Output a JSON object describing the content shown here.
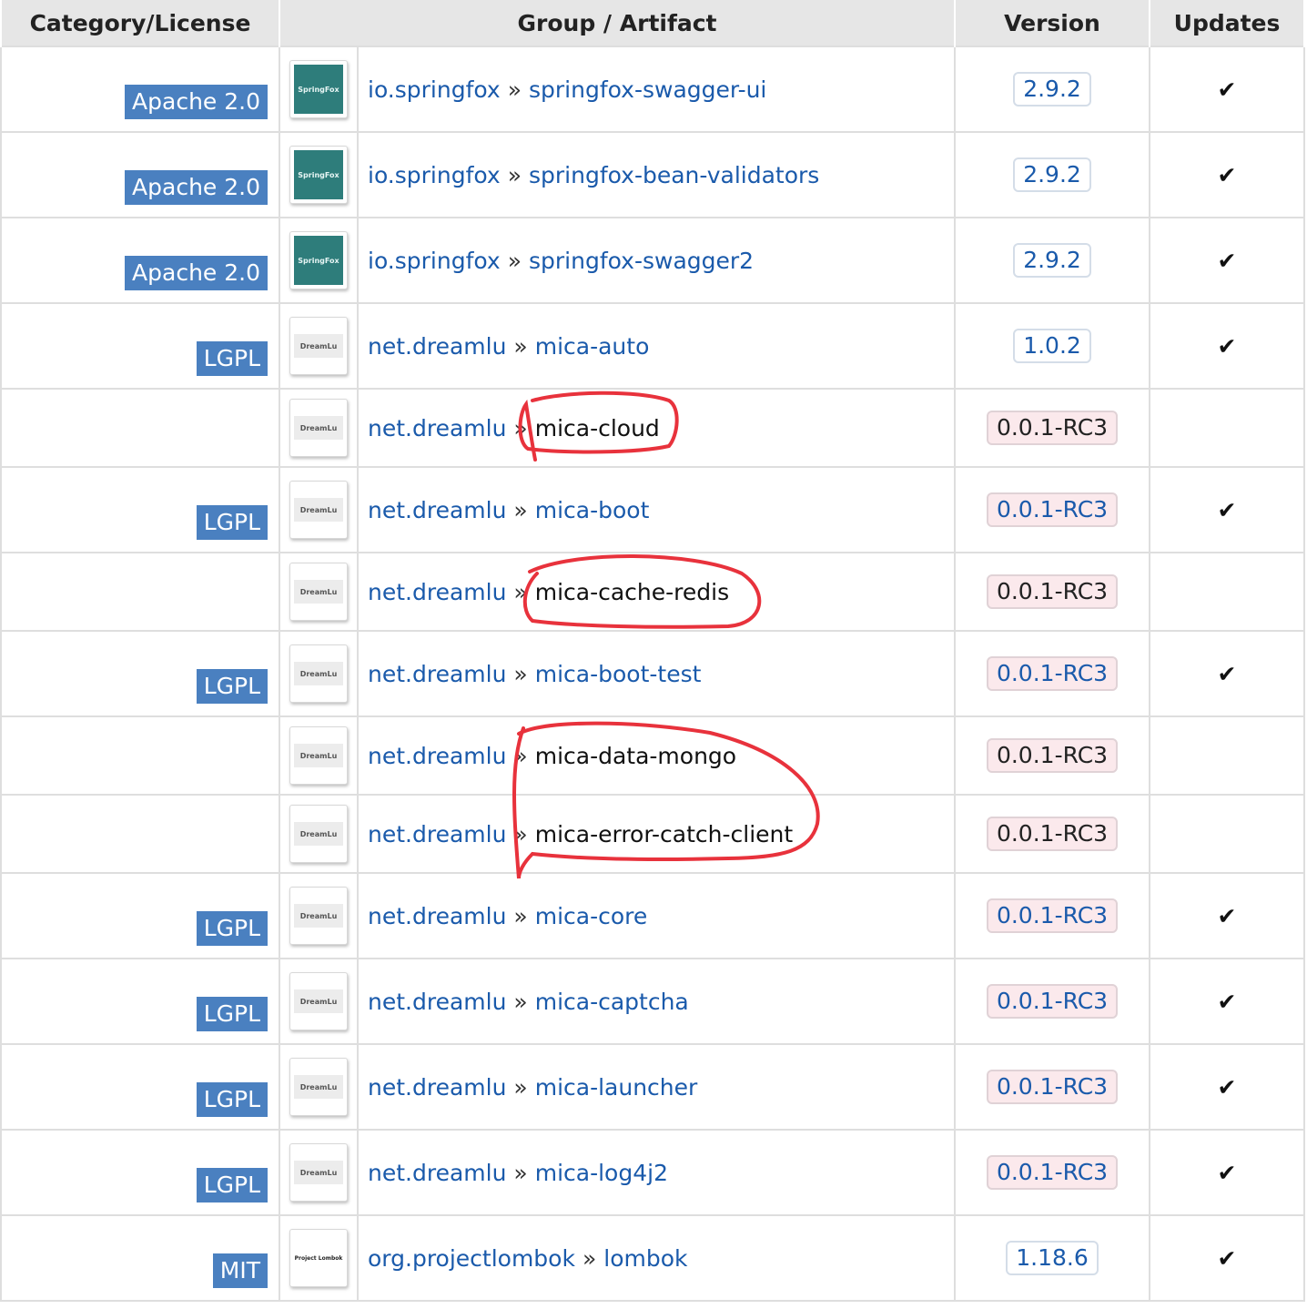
{
  "headers": {
    "license": "Category/License",
    "group_artifact": "Group / Artifact",
    "version": "Version",
    "updates": "Updates"
  },
  "separator": "»",
  "checkmark": "✔",
  "rows": [
    {
      "license": "Apache 2.0",
      "logo": "SpringFox",
      "group": "io.springfox",
      "artifact": "springfox-swagger-ui",
      "version": "2.9.2",
      "updates": "✔"
    },
    {
      "license": "Apache 2.0",
      "logo": "SpringFox",
      "group": "io.springfox",
      "artifact": "springfox-bean-validators",
      "version": "2.9.2",
      "updates": "✔"
    },
    {
      "license": "Apache 2.0",
      "logo": "SpringFox",
      "group": "io.springfox",
      "artifact": "springfox-swagger2",
      "version": "2.9.2",
      "updates": "✔"
    },
    {
      "license": "LGPL",
      "logo": "DreamLu",
      "group": "net.dreamlu",
      "artifact": "mica-auto",
      "version": "1.0.2",
      "updates": "✔"
    },
    {
      "license": "",
      "logo": "DreamLu",
      "group": "net.dreamlu",
      "artifact": "mica-cloud",
      "version": "0.0.1-RC3",
      "updates": ""
    },
    {
      "license": "LGPL",
      "logo": "DreamLu",
      "group": "net.dreamlu",
      "artifact": "mica-boot",
      "version": "0.0.1-RC3",
      "updates": "✔"
    },
    {
      "license": "",
      "logo": "DreamLu",
      "group": "net.dreamlu",
      "artifact": "mica-cache-redis",
      "version": "0.0.1-RC3",
      "updates": ""
    },
    {
      "license": "LGPL",
      "logo": "DreamLu",
      "group": "net.dreamlu",
      "artifact": "mica-boot-test",
      "version": "0.0.1-RC3",
      "updates": "✔"
    },
    {
      "license": "",
      "logo": "DreamLu",
      "group": "net.dreamlu",
      "artifact": "mica-data-mongo",
      "version": "0.0.1-RC3",
      "updates": ""
    },
    {
      "license": "",
      "logo": "DreamLu",
      "group": "net.dreamlu",
      "artifact": "mica-error-catch-client",
      "version": "0.0.1-RC3",
      "updates": ""
    },
    {
      "license": "LGPL",
      "logo": "DreamLu",
      "group": "net.dreamlu",
      "artifact": "mica-core",
      "version": "0.0.1-RC3",
      "updates": "✔"
    },
    {
      "license": "LGPL",
      "logo": "DreamLu",
      "group": "net.dreamlu",
      "artifact": "mica-captcha",
      "version": "0.0.1-RC3",
      "updates": "✔"
    },
    {
      "license": "LGPL",
      "logo": "DreamLu",
      "group": "net.dreamlu",
      "artifact": "mica-launcher",
      "version": "0.0.1-RC3",
      "updates": "✔"
    },
    {
      "license": "LGPL",
      "logo": "DreamLu",
      "group": "net.dreamlu",
      "artifact": "mica-log4j2",
      "version": "0.0.1-RC3",
      "updates": "✔"
    },
    {
      "license": "MIT",
      "logo": "Project Lombok",
      "group": "org.projectlombok",
      "artifact": "lombok",
      "version": "1.18.6",
      "updates": "✔"
    }
  ],
  "colors": {
    "license_badge": "#4a80c0",
    "link": "#1a5aab",
    "annotation": "#e8323c",
    "prerelease_bg": "#fbe9ec"
  }
}
